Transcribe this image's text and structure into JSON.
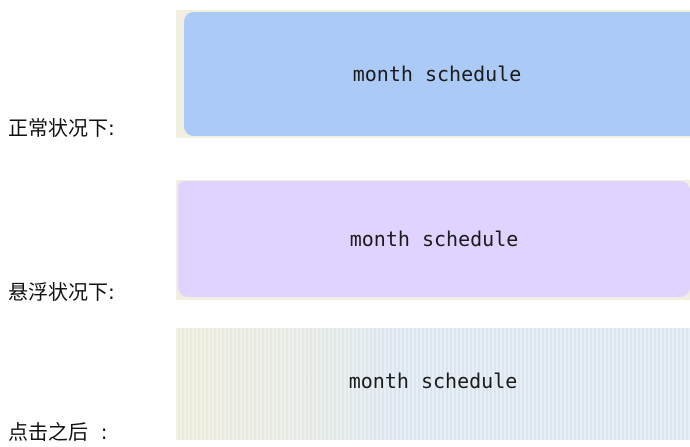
{
  "states": {
    "normal": {
      "label": "正常状况下:",
      "button_text": "month schedule",
      "color": "#abcaf5"
    },
    "hover": {
      "label": "悬浮状况下:",
      "button_text": "month schedule",
      "color": "#e0d3ff"
    },
    "clicked": {
      "label": "点击之后  :",
      "button_text": "month schedule",
      "color": "#e1ebf4"
    }
  }
}
